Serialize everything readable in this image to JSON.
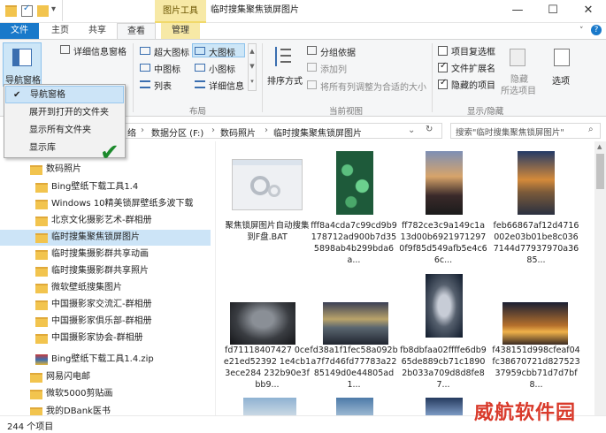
{
  "window": {
    "context_tab": "图片工具",
    "title": "临时搜集聚焦锁屏图片",
    "controls": [
      "—",
      "☐",
      "✕"
    ]
  },
  "tabs": {
    "file": "文件",
    "home": "主页",
    "share": "共享",
    "view": "查看",
    "manage": "管理"
  },
  "ribbon": {
    "nav_pane": "导航窗格",
    "details_pane": "详细信息窗格",
    "layouts": {
      "xl": "超大图标",
      "lg": "大图标",
      "md": "中图标",
      "sm": "小图标",
      "list": "列表",
      "details": "详细信息"
    },
    "group_layout": "布局",
    "sort_by": "排序方式",
    "group_by": "分组依据",
    "add_column": "添加列",
    "fit_columns": "将所有列调整为合适的大小",
    "group_current": "当前视图",
    "item_checkboxes": "项目复选框",
    "file_ext": "文件扩展名",
    "hidden_items": "隐藏的项目",
    "hide_selected_1": "隐藏",
    "hide_selected_2": "所选项目",
    "options": "选项",
    "group_showhide": "显示/隐藏",
    "checked": {
      "item_checkboxes": false,
      "file_ext": true,
      "hidden_items": true
    }
  },
  "dropdown": {
    "items": [
      "导航窗格",
      "展开到打开的文件夹",
      "显示所有文件夹",
      "显示库"
    ],
    "checked_index": 0
  },
  "address": {
    "frag": "络",
    "segments": [
      "数据分区 (F:)",
      "数码照片",
      "临时搜集聚焦锁屏图片"
    ],
    "search_placeholder": "搜索\"临时搜集聚焦锁屏图片\""
  },
  "nav": {
    "items": [
      "数码照片",
      "Bing壁纸下载工具1.4",
      "Windows 10精美锁屏壁纸多波下载",
      "北京文化摄影艺术-群相册",
      "临时搜集聚焦锁屏图片",
      "临时搜集摄影群共享动画",
      "临时搜集摄影群共享照片",
      "微软壁纸搜集图片",
      "中国摄影家交流汇-群相册",
      "中国摄影家俱乐部-群相册",
      "中国摄影家协会-群相册",
      "Bing壁纸下载工具1.4.zip",
      "网易闪电邮",
      "微软5000剪贴画",
      "我的DBank医书"
    ],
    "selected_index": 4
  },
  "files": [
    {
      "name": "聚焦锁屏图片自动搜集到F盘.BAT",
      "kind": "bat"
    },
    {
      "name": "fff8a4cda7c99cd9b9178712ad900b7d355898ab4b299bda6a...",
      "kind": "green"
    },
    {
      "name": "ff782ce3c9a149c1a13d00b69219712970f9f85d549afb5e4c66c...",
      "kind": "bridge"
    },
    {
      "name": "feb66867af12d4716002e03b01be8c0367144d77937970a3685...",
      "kind": "coast"
    },
    {
      "name": "fd71118407427 0cee21ed52392 1e4cb13ece284 232b90e3fbb9...",
      "kind": "cave"
    },
    {
      "name": "fd38a1f1fec58a092ba7f7d46fd77783a2285149d0e44805ad1...",
      "kind": "lake"
    },
    {
      "name": "fb8dbfaa02ffffe6db965de889cb71c18902b033a709d8d8fe87...",
      "kind": "space"
    },
    {
      "name": "f438151d998cfeaf04fc38670721d82752337959cbb71d7d7bf8...",
      "kind": "night"
    }
  ],
  "status": {
    "count": "244 个项目"
  },
  "watermark": "威航软件园"
}
